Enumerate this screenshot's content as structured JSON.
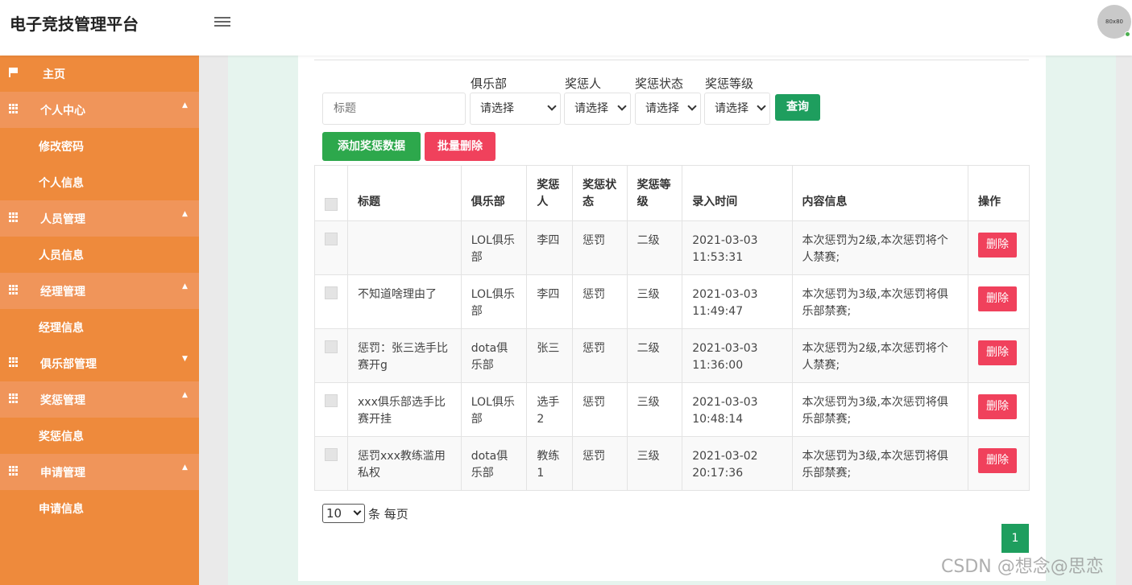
{
  "header": {
    "title": "电子竞技管理平台",
    "avatar_text": "80x80"
  },
  "sidebar": {
    "items": [
      {
        "label": "主页",
        "type": "top",
        "icon": "flag-icon"
      },
      {
        "label": "个人中心",
        "type": "group",
        "icon": "grid-icon"
      },
      {
        "label": "修改密码",
        "type": "sub"
      },
      {
        "label": "个人信息",
        "type": "sub"
      },
      {
        "label": "人员管理",
        "type": "group",
        "icon": "grid-icon"
      },
      {
        "label": "人员信息",
        "type": "sub"
      },
      {
        "label": "经理管理",
        "type": "group",
        "icon": "grid-icon"
      },
      {
        "label": "经理信息",
        "type": "sub"
      },
      {
        "label": "俱乐部管理",
        "type": "group-collapsed",
        "icon": "grid-icon"
      },
      {
        "label": "奖惩管理",
        "type": "group",
        "icon": "grid-icon"
      },
      {
        "label": "奖惩信息",
        "type": "sub"
      },
      {
        "label": "申请管理",
        "type": "group",
        "icon": "grid-icon"
      },
      {
        "label": "申请信息",
        "type": "sub"
      }
    ]
  },
  "search": {
    "title_placeholder": "标题",
    "club_label": "俱乐部",
    "person_label": "奖惩人",
    "status_label": "奖惩状态",
    "level_label": "奖惩等级",
    "select_placeholder": "请选择",
    "query_button": "查询"
  },
  "actions": {
    "add_button": "添加奖惩数据",
    "batch_delete_button": "批量删除"
  },
  "table": {
    "headers": [
      "标题",
      "俱乐部",
      "奖惩人",
      "奖惩状态",
      "奖惩等级",
      "录入时间",
      "内容信息",
      "操作"
    ],
    "rows": [
      {
        "title": "",
        "club": "LOL俱乐部",
        "person": "李四",
        "status": "惩罚",
        "level": "二级",
        "time": "2021-03-03 11:53:31",
        "content": "本次惩罚为2级,本次惩罚将个人禁赛;",
        "action": "删除"
      },
      {
        "title": "不知道啥理由了",
        "club": "LOL俱乐部",
        "person": "李四",
        "status": "惩罚",
        "level": "三级",
        "time": "2021-03-03 11:49:47",
        "content": "本次惩罚为3级,本次惩罚将俱乐部禁赛;",
        "action": "删除"
      },
      {
        "title": "惩罚：张三选手比赛开g",
        "club": "dota俱乐部",
        "person": "张三",
        "status": "惩罚",
        "level": "二级",
        "time": "2021-03-03 11:36:00",
        "content": "本次惩罚为2级,本次惩罚将个人禁赛;",
        "action": "删除"
      },
      {
        "title": "xxx俱乐部选手比赛开挂",
        "club": "LOL俱乐部",
        "person": "选手2",
        "status": "惩罚",
        "level": "三级",
        "time": "2021-03-03 10:48:14",
        "content": "本次惩罚为3级,本次惩罚将俱乐部禁赛;",
        "action": "删除"
      },
      {
        "title": "惩罚xxx教练滥用私权",
        "club": "dota俱乐部",
        "person": "教练1",
        "status": "惩罚",
        "level": "三级",
        "time": "2021-03-02 20:17:36",
        "content": "本次惩罚为3级,本次惩罚将俱乐部禁赛;",
        "action": "删除"
      }
    ]
  },
  "pagination": {
    "page_size": "10",
    "per_page_label": "条 每页",
    "current_page": "1"
  },
  "watermark": "CSDN @想念@思恋",
  "colors": {
    "sidebar": "#ee8a3c",
    "primary": "#1e9e5e",
    "danger": "#f0415c",
    "add": "#2da84c"
  }
}
